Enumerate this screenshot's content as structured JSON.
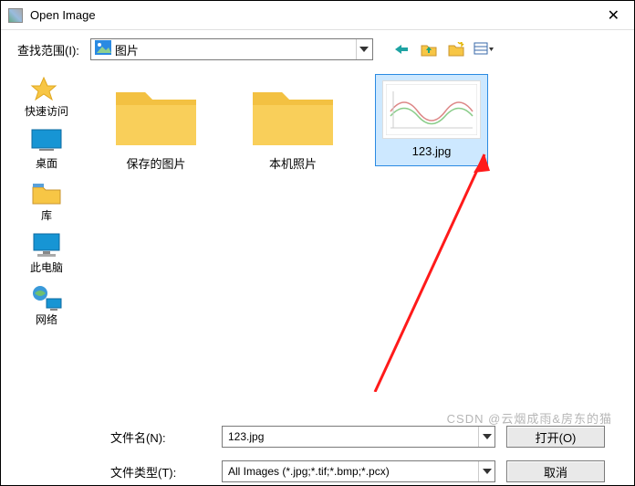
{
  "titlebar": {
    "title": "Open Image",
    "close": "✕"
  },
  "lookin": {
    "label": "查找范围(I):",
    "value": "图片"
  },
  "places": {
    "quick": "快速访问",
    "desktop": "桌面",
    "library": "库",
    "thispc": "此电脑",
    "network": "网络"
  },
  "items": {
    "folder1": "保存的图片",
    "folder2": "本机照片",
    "file1": "123.jpg"
  },
  "filename": {
    "label": "文件名(N):",
    "value": "123.jpg"
  },
  "filetype": {
    "label": "文件类型(T):",
    "value": "All Images (*.jpg;*.tif;*.bmp;*.pcx)"
  },
  "buttons": {
    "open": "打开(O)",
    "cancel": "取消"
  },
  "watermark": "CSDN @云烟成雨&房东的猫"
}
